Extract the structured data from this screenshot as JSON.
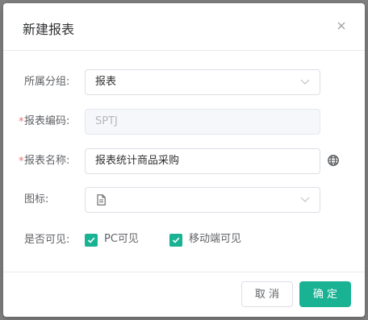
{
  "dialog": {
    "title": "新建报表",
    "close_icon": "close-icon"
  },
  "form": {
    "group": {
      "label": "所属分组:",
      "value": "报表"
    },
    "code": {
      "required_mark": "*",
      "label": "报表编码:",
      "value": "SPTJ",
      "disabled": true
    },
    "name": {
      "required_mark": "*",
      "label": "报表名称:",
      "value": "报表统计商品采购",
      "i18n_icon": "globe-icon"
    },
    "icon": {
      "label": "图标:",
      "selected_icon": "file-icon"
    },
    "visible": {
      "label": "是否可见:",
      "options": [
        {
          "label": "PC可见",
          "checked": true
        },
        {
          "label": "移动端可见",
          "checked": true
        }
      ]
    }
  },
  "footer": {
    "cancel_label": "取 消",
    "confirm_label": "确 定"
  },
  "colors": {
    "accent": "#19b394",
    "required": "#f56c6c"
  }
}
